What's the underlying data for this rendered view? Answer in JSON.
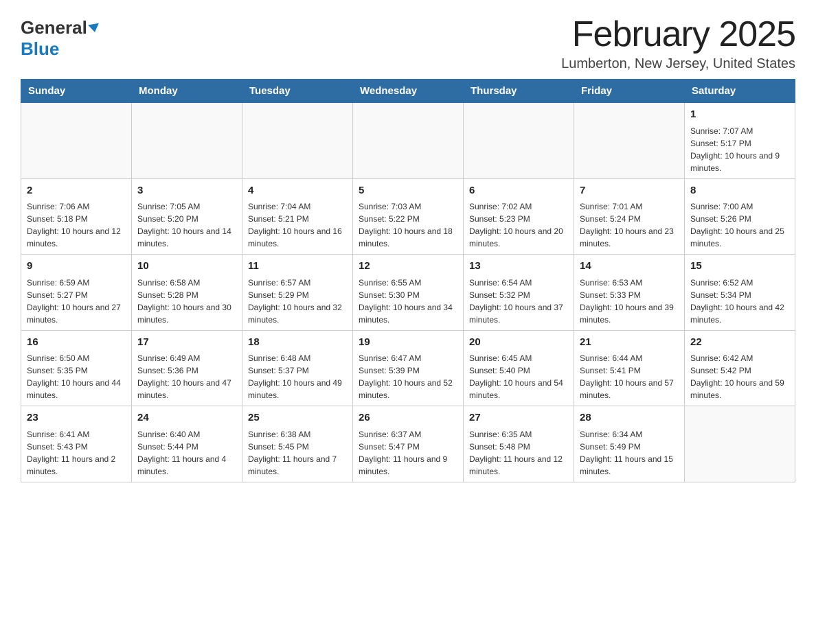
{
  "header": {
    "logo_general": "General",
    "logo_blue": "Blue",
    "title": "February 2025",
    "location": "Lumberton, New Jersey, United States"
  },
  "days_of_week": [
    "Sunday",
    "Monday",
    "Tuesday",
    "Wednesday",
    "Thursday",
    "Friday",
    "Saturday"
  ],
  "weeks": [
    {
      "days": [
        {
          "num": "",
          "info": ""
        },
        {
          "num": "",
          "info": ""
        },
        {
          "num": "",
          "info": ""
        },
        {
          "num": "",
          "info": ""
        },
        {
          "num": "",
          "info": ""
        },
        {
          "num": "",
          "info": ""
        },
        {
          "num": "1",
          "info": "Sunrise: 7:07 AM\nSunset: 5:17 PM\nDaylight: 10 hours and 9 minutes."
        }
      ]
    },
    {
      "days": [
        {
          "num": "2",
          "info": "Sunrise: 7:06 AM\nSunset: 5:18 PM\nDaylight: 10 hours and 12 minutes."
        },
        {
          "num": "3",
          "info": "Sunrise: 7:05 AM\nSunset: 5:20 PM\nDaylight: 10 hours and 14 minutes."
        },
        {
          "num": "4",
          "info": "Sunrise: 7:04 AM\nSunset: 5:21 PM\nDaylight: 10 hours and 16 minutes."
        },
        {
          "num": "5",
          "info": "Sunrise: 7:03 AM\nSunset: 5:22 PM\nDaylight: 10 hours and 18 minutes."
        },
        {
          "num": "6",
          "info": "Sunrise: 7:02 AM\nSunset: 5:23 PM\nDaylight: 10 hours and 20 minutes."
        },
        {
          "num": "7",
          "info": "Sunrise: 7:01 AM\nSunset: 5:24 PM\nDaylight: 10 hours and 23 minutes."
        },
        {
          "num": "8",
          "info": "Sunrise: 7:00 AM\nSunset: 5:26 PM\nDaylight: 10 hours and 25 minutes."
        }
      ]
    },
    {
      "days": [
        {
          "num": "9",
          "info": "Sunrise: 6:59 AM\nSunset: 5:27 PM\nDaylight: 10 hours and 27 minutes."
        },
        {
          "num": "10",
          "info": "Sunrise: 6:58 AM\nSunset: 5:28 PM\nDaylight: 10 hours and 30 minutes."
        },
        {
          "num": "11",
          "info": "Sunrise: 6:57 AM\nSunset: 5:29 PM\nDaylight: 10 hours and 32 minutes."
        },
        {
          "num": "12",
          "info": "Sunrise: 6:55 AM\nSunset: 5:30 PM\nDaylight: 10 hours and 34 minutes."
        },
        {
          "num": "13",
          "info": "Sunrise: 6:54 AM\nSunset: 5:32 PM\nDaylight: 10 hours and 37 minutes."
        },
        {
          "num": "14",
          "info": "Sunrise: 6:53 AM\nSunset: 5:33 PM\nDaylight: 10 hours and 39 minutes."
        },
        {
          "num": "15",
          "info": "Sunrise: 6:52 AM\nSunset: 5:34 PM\nDaylight: 10 hours and 42 minutes."
        }
      ]
    },
    {
      "days": [
        {
          "num": "16",
          "info": "Sunrise: 6:50 AM\nSunset: 5:35 PM\nDaylight: 10 hours and 44 minutes."
        },
        {
          "num": "17",
          "info": "Sunrise: 6:49 AM\nSunset: 5:36 PM\nDaylight: 10 hours and 47 minutes."
        },
        {
          "num": "18",
          "info": "Sunrise: 6:48 AM\nSunset: 5:37 PM\nDaylight: 10 hours and 49 minutes."
        },
        {
          "num": "19",
          "info": "Sunrise: 6:47 AM\nSunset: 5:39 PM\nDaylight: 10 hours and 52 minutes."
        },
        {
          "num": "20",
          "info": "Sunrise: 6:45 AM\nSunset: 5:40 PM\nDaylight: 10 hours and 54 minutes."
        },
        {
          "num": "21",
          "info": "Sunrise: 6:44 AM\nSunset: 5:41 PM\nDaylight: 10 hours and 57 minutes."
        },
        {
          "num": "22",
          "info": "Sunrise: 6:42 AM\nSunset: 5:42 PM\nDaylight: 10 hours and 59 minutes."
        }
      ]
    },
    {
      "days": [
        {
          "num": "23",
          "info": "Sunrise: 6:41 AM\nSunset: 5:43 PM\nDaylight: 11 hours and 2 minutes."
        },
        {
          "num": "24",
          "info": "Sunrise: 6:40 AM\nSunset: 5:44 PM\nDaylight: 11 hours and 4 minutes."
        },
        {
          "num": "25",
          "info": "Sunrise: 6:38 AM\nSunset: 5:45 PM\nDaylight: 11 hours and 7 minutes."
        },
        {
          "num": "26",
          "info": "Sunrise: 6:37 AM\nSunset: 5:47 PM\nDaylight: 11 hours and 9 minutes."
        },
        {
          "num": "27",
          "info": "Sunrise: 6:35 AM\nSunset: 5:48 PM\nDaylight: 11 hours and 12 minutes."
        },
        {
          "num": "28",
          "info": "Sunrise: 6:34 AM\nSunset: 5:49 PM\nDaylight: 11 hours and 15 minutes."
        },
        {
          "num": "",
          "info": ""
        }
      ]
    }
  ]
}
